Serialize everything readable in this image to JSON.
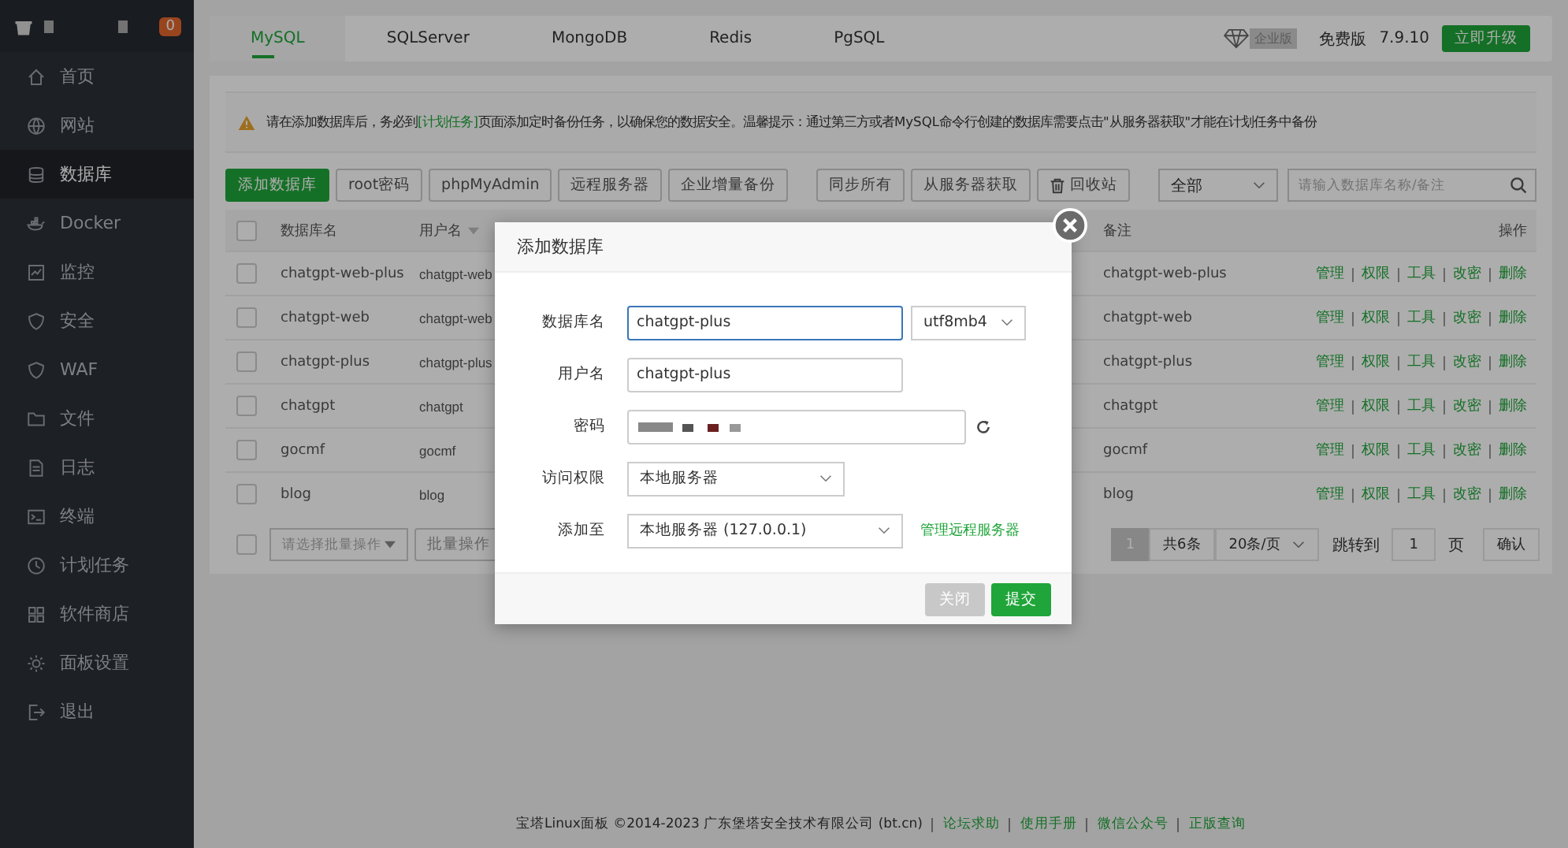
{
  "sidebar": {
    "badge": "0",
    "items": [
      {
        "label": "首页",
        "selected": false
      },
      {
        "label": "网站",
        "selected": false
      },
      {
        "label": "数据库",
        "selected": true
      },
      {
        "label": "Docker",
        "selected": false
      },
      {
        "label": "监控",
        "selected": false
      },
      {
        "label": "安全",
        "selected": false
      },
      {
        "label": "WAF",
        "selected": false
      },
      {
        "label": "文件",
        "selected": false
      },
      {
        "label": "日志",
        "selected": false
      },
      {
        "label": "终端",
        "selected": false
      },
      {
        "label": "计划任务",
        "selected": false
      },
      {
        "label": "软件商店",
        "selected": false
      },
      {
        "label": "面板设置",
        "selected": false
      },
      {
        "label": "退出",
        "selected": false
      }
    ]
  },
  "tabs": [
    {
      "label": "MySQL",
      "selected": true
    },
    {
      "label": "SQLServer",
      "selected": false
    },
    {
      "label": "MongoDB",
      "selected": false
    },
    {
      "label": "Redis",
      "selected": false
    },
    {
      "label": "PgSQL",
      "selected": false
    }
  ],
  "edition": {
    "badge": "企业版",
    "label": "免费版",
    "version": "7.9.10",
    "upgrade": "立即升级"
  },
  "notice": {
    "before": "请在添加数据库后，务必到",
    "link": "[计划任务]",
    "after": "页面添加定时备份任务，以确保您的数据安全。温馨提示：通过第三方或者MySQL命令行创建的数据库需要点击\"从服务器获取\"才能在计划任务中备份"
  },
  "toolbar": [
    {
      "label": "添加数据库",
      "kind": "primary"
    },
    {
      "label": "root密码",
      "kind": "default"
    },
    {
      "label": "phpMyAdmin",
      "kind": "default"
    },
    {
      "label": "远程服务器",
      "kind": "default"
    },
    {
      "label": "企业增量备份",
      "kind": "default"
    },
    {
      "label": "同步所有",
      "kind": "group"
    },
    {
      "label": "从服务器获取",
      "kind": "default"
    },
    {
      "label": "回收站",
      "kind": "trash"
    }
  ],
  "filter": {
    "value": "全部"
  },
  "search": {
    "placeholder": "请输入数据库名称/备注"
  },
  "table": {
    "columns": [
      "数据库名",
      "用户名",
      "备注",
      "操作"
    ],
    "all_checked": false,
    "rows": [
      {
        "checked": false,
        "name": "chatgpt-web-plus",
        "user": "chatgpt-web",
        "remark": "chatgpt-web-plus",
        "actions": [
          "管理",
          "权限",
          "工具",
          "改密",
          "删除"
        ]
      },
      {
        "checked": false,
        "name": "chatgpt-web",
        "user": "chatgpt-web",
        "remark": "chatgpt-web",
        "actions": [
          "管理",
          "权限",
          "工具",
          "改密",
          "删除"
        ]
      },
      {
        "checked": false,
        "name": "chatgpt-plus",
        "user": "chatgpt-plus",
        "remark": "chatgpt-plus",
        "actions": [
          "管理",
          "权限",
          "工具",
          "改密",
          "删除"
        ]
      },
      {
        "checked": false,
        "name": "chatgpt",
        "user": "chatgpt",
        "remark": "chatgpt",
        "actions": [
          "管理",
          "权限",
          "工具",
          "改密",
          "删除"
        ]
      },
      {
        "checked": false,
        "name": "gocmf",
        "user": "gocmf",
        "remark": "gocmf",
        "actions": [
          "管理",
          "权限",
          "工具",
          "改密",
          "删除"
        ]
      },
      {
        "checked": false,
        "name": "blog",
        "user": "blog",
        "remark": "blog",
        "actions": [
          "管理",
          "权限",
          "工具",
          "改密",
          "删除"
        ]
      }
    ]
  },
  "batch": {
    "checked": false,
    "placeholder": "请选择批量操作",
    "button": "批量操作"
  },
  "pagination": {
    "page": "1",
    "total": "共6条",
    "per_page": "20条/页",
    "jump_label": "跳转到",
    "jump_value": "1",
    "page_unit": "页",
    "confirm": "确认"
  },
  "dialog": {
    "title": "添加数据库",
    "fields": [
      {
        "label": "数据库名",
        "kind": "input",
        "value": "chatgpt-plus",
        "focused": true,
        "charset": "utf8mb4"
      },
      {
        "label": "用户名",
        "kind": "input",
        "value": "chatgpt-plus",
        "focused": false
      },
      {
        "label": "密码",
        "kind": "password",
        "focused": false
      },
      {
        "label": "访问权限",
        "kind": "select",
        "value": "本地服务器",
        "focused": false
      },
      {
        "label": "添加至",
        "kind": "select",
        "value": "本地服务器 (127.0.0.1)",
        "focused": false,
        "link": "管理远程服务器"
      }
    ],
    "buttons": [
      {
        "label": "关闭",
        "kind": "disabled"
      },
      {
        "label": "提交",
        "kind": "primary"
      }
    ]
  },
  "footer": {
    "copyright": "宝塔Linux面板 ©2014-2023 广东堡塔安全技术有限公司 (bt.cn)",
    "links": [
      "论坛求助",
      "使用手册",
      "微信公众号",
      "正版查询"
    ]
  }
}
